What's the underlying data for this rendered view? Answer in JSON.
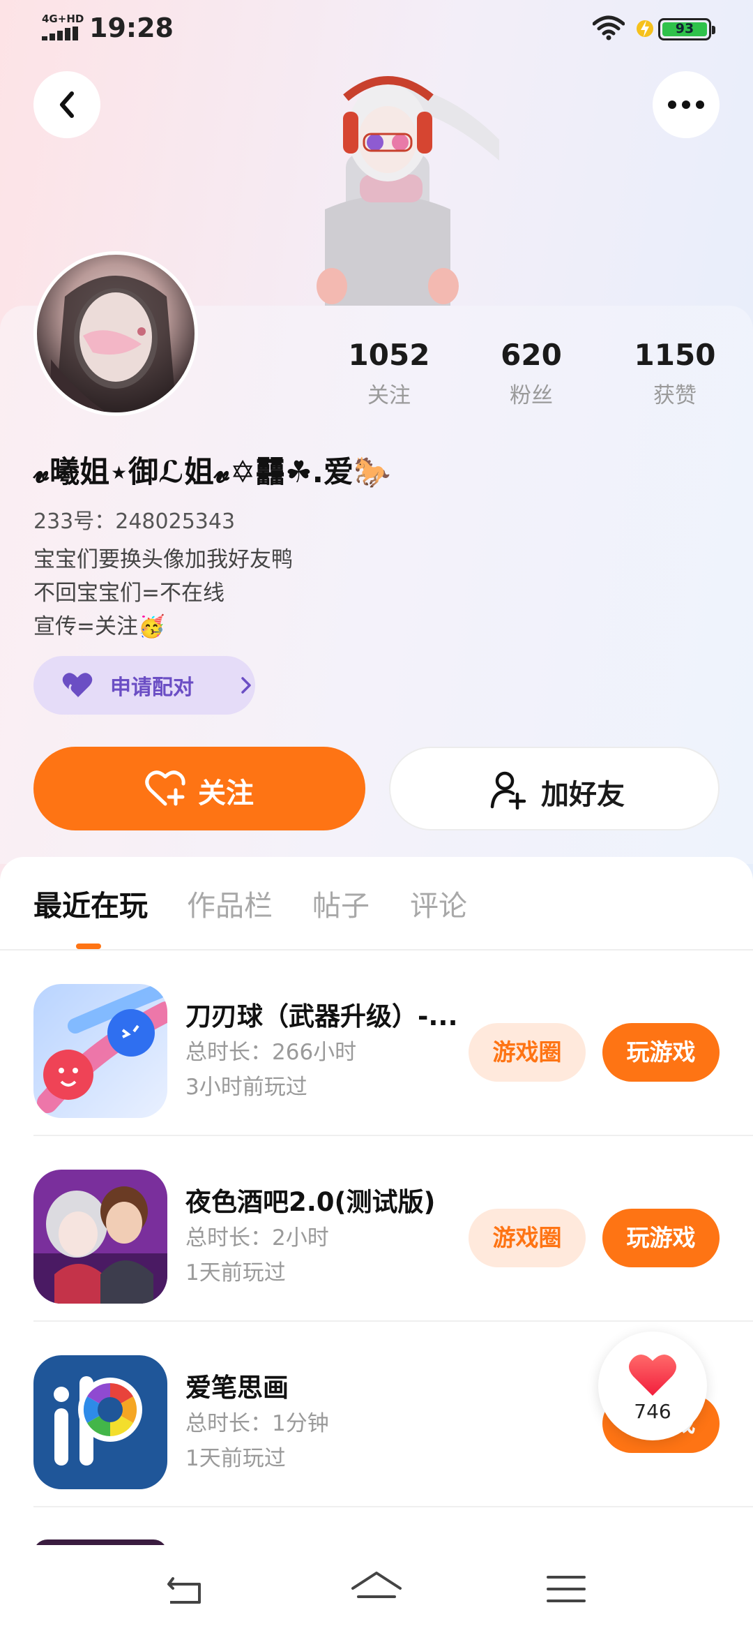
{
  "status_bar": {
    "network": "4G+HD",
    "time": "19:28",
    "battery": "93",
    "colors": {
      "battery_fill": "#2fc24b"
    }
  },
  "header": {
    "back_icon": "chevron-left-icon",
    "more_icon": "more-horizontal-icon"
  },
  "profile": {
    "stats": [
      {
        "value": "1052",
        "label": "关注"
      },
      {
        "value": "620",
        "label": "粉丝"
      },
      {
        "value": "1150",
        "label": "获赞"
      }
    ],
    "nickname": "𝓿曦姐⋆御ℒ姐𝓿✡䨻☘.爱🐎",
    "uid": "233号：248025343",
    "bio": [
      "宝宝们要换头像加我好友鸭",
      "不回宝宝们=不在线",
      "宣传=关注🥳"
    ],
    "pair_button": "申请配对",
    "follow_button": "关注",
    "add_friend_button": "加好友"
  },
  "tabs": {
    "items": [
      "最近在玩",
      "作品栏",
      "帖子",
      "评论"
    ],
    "active_index": 0
  },
  "games": [
    {
      "name": "刀刃球（武器升级）-...",
      "duration": "总时长：266小时",
      "last_played": "3小时前玩过",
      "circle_label": "游戏圈",
      "play_label": "玩游戏"
    },
    {
      "name": "夜色酒吧2.0(测试版)",
      "duration": "总时长：2小时",
      "last_played": "1天前玩过",
      "circle_label": "游戏圈",
      "play_label": "玩游戏"
    },
    {
      "name": "爱笔思画",
      "duration": "总时长：1分钟",
      "last_played": "1天前玩过",
      "circle_label": "",
      "play_label": "玩游戏"
    }
  ],
  "floating_like": {
    "count": "746",
    "icon": "heart-icon"
  },
  "colors": {
    "accent": "#fe7414",
    "accent_light": "#ffe9dc",
    "pair_bg": "#e5dcf8",
    "pair_text": "#6b4ec4"
  },
  "nav_bar": {
    "icons": [
      "back-icon",
      "home-icon",
      "menu-icon"
    ]
  }
}
